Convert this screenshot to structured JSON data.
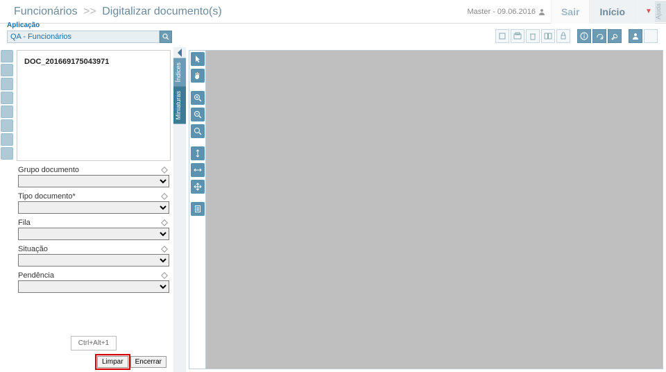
{
  "header": {
    "crumb_root": "Funcionários",
    "crumb_current": "Digitalizar documento(s)",
    "master_label": "Master - 09.06.2016",
    "sair": "Sair",
    "inicio": "Início",
    "alert": "▼",
    "ajuda": "Ajuda"
  },
  "app": {
    "label": "Aplicação",
    "value": "QA - Funcionários"
  },
  "doc": {
    "name": "DOC_201669175043971"
  },
  "tabs": {
    "indices": "Índices",
    "miniaturas": "Miniaturas"
  },
  "fields": {
    "grupo": {
      "label": "Grupo documento"
    },
    "tipo": {
      "label": "Tipo documento*"
    },
    "fila": {
      "label": "Fila"
    },
    "situacao": {
      "label": "Situação"
    },
    "pendencia": {
      "label": "Pendência"
    }
  },
  "actions": {
    "shortcut": "Ctrl+Alt+1",
    "limpar": "Limpar",
    "encerrar": "Encerrar"
  }
}
